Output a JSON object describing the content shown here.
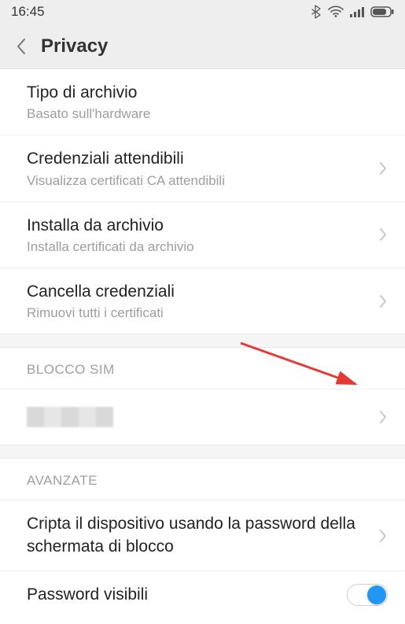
{
  "status": {
    "time": "16:45"
  },
  "header": {
    "title": "Privacy"
  },
  "items": {
    "archive_type": {
      "title": "Tipo di archivio",
      "sub": "Basato sull'hardware"
    },
    "trusted_creds": {
      "title": "Credenziali attendibili",
      "sub": "Visualizza certificati CA attendibili"
    },
    "install_from": {
      "title": "Installa da archivio",
      "sub": "Installa certificati da archivio"
    },
    "clear_creds": {
      "title": "Cancella credenziali",
      "sub": "Rimuovi tutti i certificati"
    },
    "encrypt": {
      "title": "Cripta il dispositivo usando la password della schermata di blocco"
    },
    "visible_pw": {
      "title": "Password visibili"
    }
  },
  "sections": {
    "sim_lock": "BLOCCO SIM",
    "advanced": "AVANZATE"
  }
}
